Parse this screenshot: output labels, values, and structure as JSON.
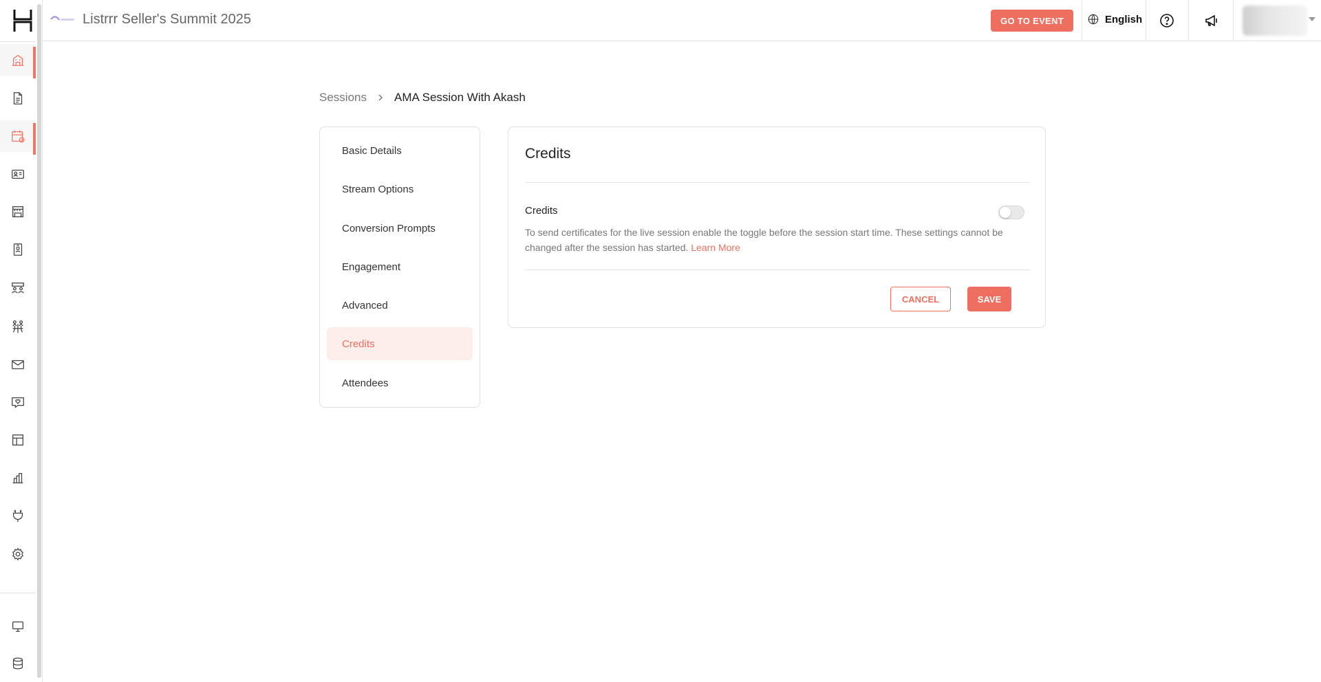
{
  "header": {
    "event_title": "Listrrr Seller's Summit 2025",
    "go_to_event_label": "GO TO EVENT",
    "language_label": "English"
  },
  "sidebar": {
    "items": [
      {
        "icon": "building-icon",
        "active": true
      },
      {
        "icon": "document-icon",
        "active": false
      },
      {
        "icon": "calendar-icon",
        "active": true
      },
      {
        "icon": "id-card-icon",
        "active": false
      },
      {
        "icon": "booth-icon",
        "active": false
      },
      {
        "icon": "badge-icon",
        "active": false
      },
      {
        "icon": "people-group-icon",
        "active": false
      },
      {
        "icon": "networking-icon",
        "active": false
      },
      {
        "icon": "mail-icon",
        "active": false
      },
      {
        "icon": "chat-heart-icon",
        "active": false
      },
      {
        "icon": "layout-icon",
        "active": false
      },
      {
        "icon": "bar-chart-icon",
        "active": false
      },
      {
        "icon": "plug-icon",
        "active": false
      },
      {
        "icon": "gear-icon",
        "active": false
      },
      {
        "icon": "monitor-icon",
        "active": false
      },
      {
        "icon": "database-icon",
        "active": false
      }
    ]
  },
  "breadcrumb": {
    "parent": "Sessions",
    "current": "AMA Session With Akash"
  },
  "menu": {
    "items": [
      {
        "label": "Basic Details"
      },
      {
        "label": "Stream Options"
      },
      {
        "label": "Conversion Prompts"
      },
      {
        "label": "Engagement"
      },
      {
        "label": "Advanced"
      },
      {
        "label": "Credits"
      },
      {
        "label": "Attendees"
      }
    ],
    "active_index": 5
  },
  "credits_panel": {
    "title": "Credits",
    "toggle_label": "Credits",
    "toggle_on": false,
    "description": "To send certificates for the live session enable the toggle before the session start time. These settings cannot be changed after the session has started.",
    "learn_more": "Learn More",
    "cancel_label": "CANCEL",
    "save_label": "SAVE"
  },
  "colors": {
    "accent": "#ee6f5f",
    "active_bg": "#fdeeeb"
  }
}
